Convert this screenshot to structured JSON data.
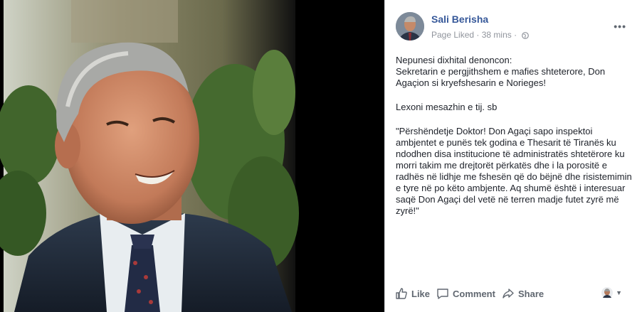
{
  "post": {
    "author": "Sali Berisha",
    "page_status": "Page Liked",
    "separator": "·",
    "time_ago": "38 mins",
    "paragraphs": [
      "Nepunesi dixhital denoncon:\nSekretarin e pergjithshem e mafies shteterore, Don Agaçion si kryefshesarin e Norieges!",
      "Lexoni mesazhin e tij. sb",
      "\"Përshëndetje Doktor! Don Agaçi sapo inspektoi ambjentet e punës tek godina e Thesarit të Tiranës ku ndodhen disa institucione të administratës shtetërore ku morri takim me drejtorët përkatës dhe i la porositë e radhës në lidhje me fshesën që do bëjnë dhe risistemimin e tyre në po këto ambjente. Aq shumë është i interesuar saqë Don Agaçi del vetë në terren madje futet zyrë më zyrë!\""
    ]
  },
  "actions": {
    "like": "Like",
    "comment": "Comment",
    "share": "Share"
  },
  "icons": {
    "globe": "globe-icon",
    "options": "more-options-icon",
    "like": "thumbs-up-icon",
    "comment": "speech-bubble-icon",
    "share": "share-arrow-icon",
    "audience": "audience-avatar-icon"
  },
  "colors": {
    "author_link": "#365899",
    "meta_text": "#90949c",
    "body_text": "#1d2129",
    "action_text": "#606770"
  }
}
